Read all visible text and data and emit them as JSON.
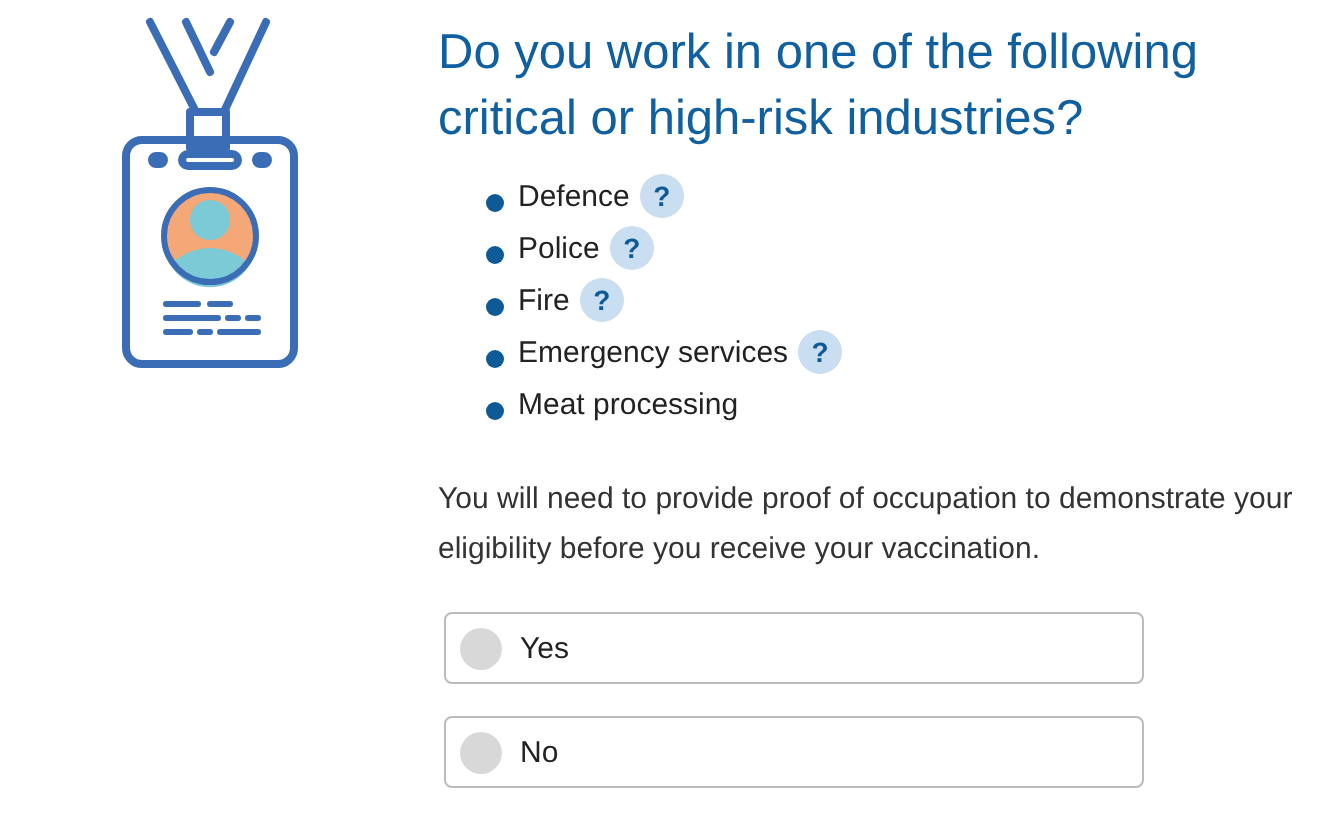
{
  "question": {
    "title": "Do you work in one of the following critical or high-risk industries?"
  },
  "industries": [
    {
      "label": "Defence",
      "help": "?"
    },
    {
      "label": "Police",
      "help": "?"
    },
    {
      "label": "Fire",
      "help": "?"
    },
    {
      "label": "Emergency services",
      "help": "?"
    },
    {
      "label": "Meat processing"
    }
  ],
  "note": "You will need to provide proof of occupation to demonstrate your eligibility before you receive your vaccination.",
  "options": [
    {
      "label": "Yes",
      "selected": false
    },
    {
      "label": "No",
      "selected": false
    }
  ]
}
